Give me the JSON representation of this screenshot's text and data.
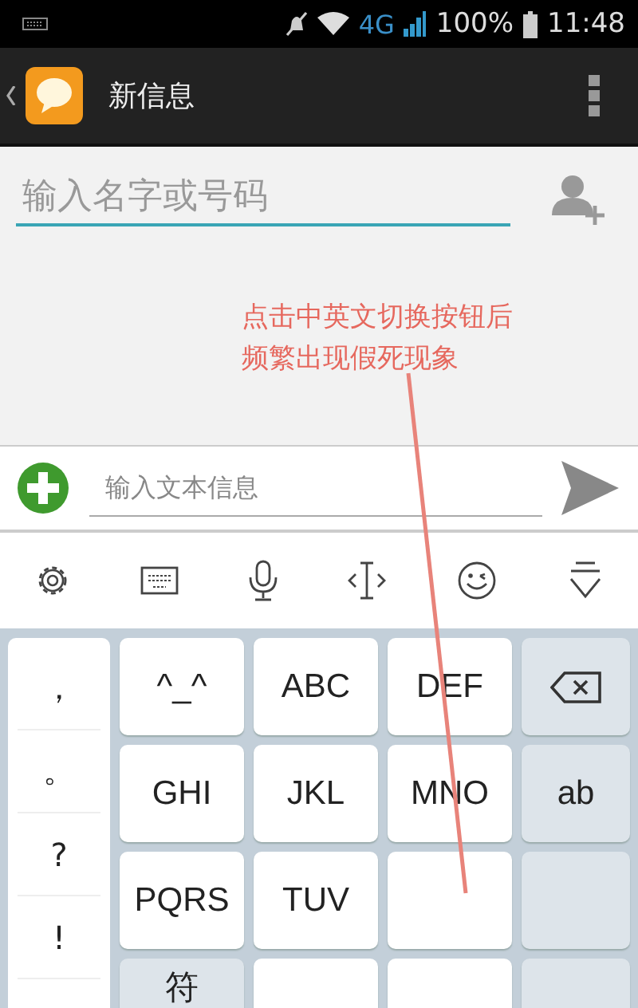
{
  "status_bar": {
    "network": "4G",
    "battery": "100%",
    "time": "11:48"
  },
  "action_bar": {
    "title": "新信息"
  },
  "recipient": {
    "placeholder": "输入名字或号码"
  },
  "annotation": {
    "text": "点击中英文切换按钮后频繁出现假死现象"
  },
  "compose": {
    "placeholder": "输入文本信息"
  },
  "keyboard": {
    "punctuation": [
      "，",
      "。",
      "?",
      "!"
    ],
    "rows": [
      [
        "^_^",
        "ABC",
        "DEF"
      ],
      [
        "GHI",
        "JKL",
        "MNO"
      ],
      [
        "PQRS",
        "TUV"
      ],
      [
        "符"
      ]
    ],
    "side_keys": [
      {
        "kind": "backspace"
      },
      {
        "kind": "label",
        "label": "ab"
      }
    ]
  }
}
